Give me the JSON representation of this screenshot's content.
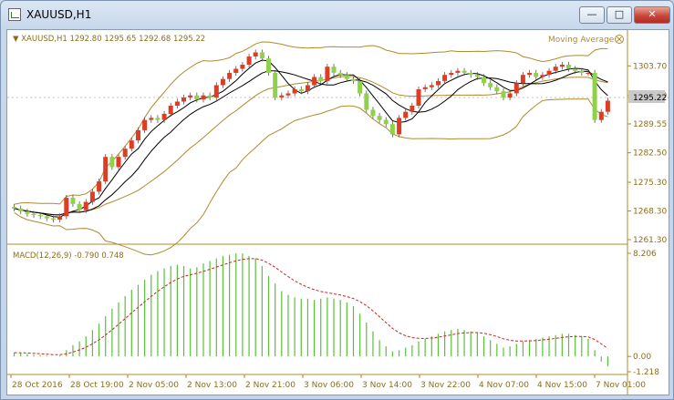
{
  "window": {
    "title": "XAUUSD,H1",
    "minimize_icon": "minimize-icon",
    "maximize_icon": "maximize-icon",
    "close_icon": "close-icon"
  },
  "colors": {
    "bull_candle": "#e03b23",
    "bear_candle": "#8fd24a",
    "band_line": "#b08b2c",
    "ma_line": "#000000",
    "macd_hist": "#5bbf3c",
    "macd_signal": "#d42020",
    "axis_text": "#8a6d1c",
    "price_tag_bg": "#c9c9c9"
  },
  "main_panel": {
    "symbol_info": "▼ XAUUSD,H1  1292.80 1295.65 1292.68 1295.22",
    "indicator_label": "Moving Average",
    "current_price": "1295.22",
    "y_ticks": [
      "1303.70",
      "1296.50",
      "1289.55",
      "1282.50",
      "1275.30",
      "1268.30",
      "1261.30"
    ]
  },
  "macd_panel": {
    "label": "MACD(12,26,9) -0.790 0.748",
    "y_ticks": [
      "8.206",
      "0.00",
      "-1.218"
    ]
  },
  "x_ticks": [
    "28 Oct 2016",
    "28 Oct 19:00",
    "2 Nov 05:00",
    "2 Nov 13:00",
    "2 Nov 21:00",
    "3 Nov 06:00",
    "3 Nov 14:00",
    "3 Nov 22:00",
    "4 Nov 07:00",
    "4 Nov 15:00",
    "7 Nov 01:00"
  ],
  "chart_data": {
    "type": "candlestick",
    "symbol": "XAUUSD",
    "timeframe": "H1",
    "ylim": [
      1261.3,
      1310.0
    ],
    "candles_close": [
      1268.9,
      1268.2,
      1267.6,
      1267.3,
      1267.0,
      1266.5,
      1266.2,
      1267.0,
      1271.5,
      1270.0,
      1268.5,
      1270.5,
      1273.0,
      1275.5,
      1281.5,
      1279.0,
      1281.5,
      1283.5,
      1285.5,
      1288.0,
      1290.5,
      1291.0,
      1290.5,
      1292.0,
      1294.0,
      1295.0,
      1296.0,
      1296.5,
      1295.5,
      1296.5,
      1296.0,
      1299.0,
      1300.5,
      1302.0,
      1303.0,
      1304.0,
      1306.0,
      1307.0,
      1305.5,
      1302.0,
      1296.0,
      1296.5,
      1297.0,
      1298.0,
      1297.5,
      1299.0,
      1301.0,
      1300.0,
      1303.5,
      1302.0,
      1301.5,
      1300.5,
      1300.0,
      1297.0,
      1293.0,
      1291.5,
      1290.5,
      1289.5,
      1287.0,
      1291.0,
      1292.5,
      1294.0,
      1298.0,
      1298.5,
      1299.0,
      1300.0,
      1301.5,
      1302.0,
      1302.5,
      1302.0,
      1301.5,
      1301.0,
      1299.5,
      1298.5,
      1297.5,
      1296.0,
      1297.0,
      1299.5,
      1301.5,
      1302.0,
      1301.0,
      1301.5,
      1302.5,
      1303.5,
      1304.0,
      1303.0,
      1302.5,
      1302.0,
      1302.0,
      1290.5,
      1292.5,
      1295.22
    ],
    "macd_histogram": [
      0.3,
      0.25,
      0.2,
      0.15,
      0.1,
      0.05,
      0.0,
      0.1,
      0.5,
      0.9,
      1.2,
      1.6,
      2.1,
      2.6,
      3.2,
      3.8,
      4.3,
      4.8,
      5.3,
      5.7,
      6.1,
      6.5,
      6.8,
      7.0,
      7.2,
      7.3,
      7.2,
      7.0,
      7.1,
      7.4,
      7.6,
      7.8,
      8.0,
      8.1,
      8.2,
      8.2,
      8.0,
      7.8,
      7.2,
      6.4,
      5.8,
      5.2,
      4.9,
      4.7,
      4.6,
      4.6,
      4.5,
      4.6,
      4.7,
      4.6,
      4.5,
      4.3,
      4.0,
      3.4,
      2.7,
      2.0,
      1.3,
      0.8,
      0.4,
      0.5,
      0.7,
      0.9,
      1.2,
      1.4,
      1.6,
      1.8,
      2.0,
      2.1,
      2.2,
      2.1,
      2.0,
      1.9,
      1.6,
      1.3,
      1.0,
      0.7,
      0.8,
      1.0,
      1.2,
      1.3,
      1.4,
      1.5,
      1.6,
      1.7,
      1.8,
      1.8,
      1.7,
      1.6,
      1.4,
      0.5,
      -0.4,
      -0.79
    ],
    "macd_signal_value": 0.748,
    "macd_ylim": [
      -1.218,
      8.206
    ]
  }
}
